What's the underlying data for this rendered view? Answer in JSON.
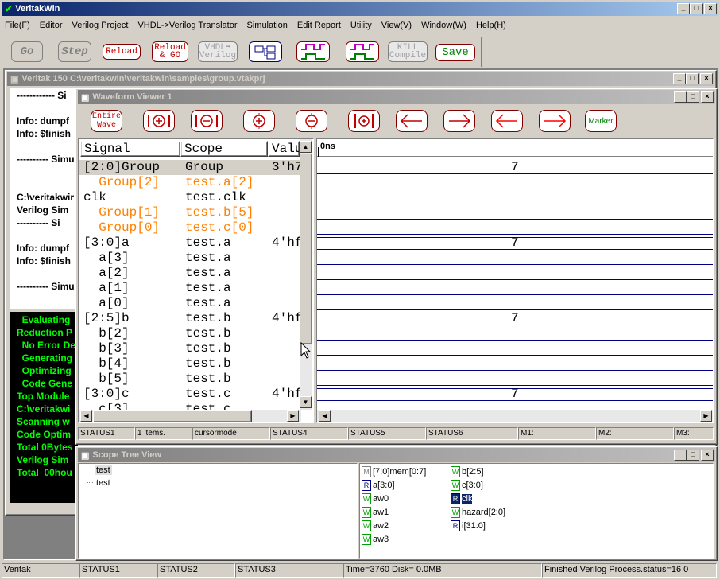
{
  "app": {
    "title": "VeritakWin"
  },
  "menu": [
    "File(F)",
    "Editor",
    "Verilog Project",
    "VHDL->Verilog Translator",
    "Simulation",
    "Edit Report",
    "Utility",
    "View(V)",
    "Window(W)",
    "Help(H)"
  ],
  "toolbar": {
    "go": "Go",
    "step": "Step",
    "reload": "Reload",
    "reload_go_1": "Reload",
    "reload_go_2": "& GO",
    "vhdl_1": "VHDL➡",
    "vhdl_2": "Verilog",
    "kill_1": "KILL",
    "kill_2": "Compile",
    "save": "Save"
  },
  "project_window": {
    "title": "Veritak 150 C:\\veritakwin\\veritakwin\\samples\\group.vtakprj",
    "console": [
      "------------ Si",
      "",
      "Info: dumpf",
      "Info: $finish",
      "",
      "---------- Simu",
      "",
      "",
      "C:\\veritakwir",
      "Verilog Sim",
      "---------- Si",
      "",
      "Info: dumpf",
      "Info: $finish",
      "",
      "---------- Simu"
    ],
    "green": [
      "  Evaluating",
      "Reduction P",
      "  No Error De",
      "  Generating",
      "  Optimizing",
      "  Code Gene",
      "Top Module",
      "C:\\veritakwi",
      "Scanning w",
      "Code Optim",
      "Total 0Bytes",
      "Verilog Sim",
      "Total  00hou"
    ]
  },
  "waveform": {
    "title": "Waveform Viewer 1",
    "btn_entire_1": "Entire",
    "btn_entire_2": "Wave",
    "btn_marker": "Marker",
    "headers": {
      "signal": "Signal",
      "scope": "Scope",
      "value": "Valu"
    },
    "time_label": "0ns",
    "rows": [
      {
        "signal": "[2:0]Group",
        "scope": "Group",
        "value": "3'h7",
        "orange": false,
        "selected": true,
        "wave": "7"
      },
      {
        "signal": "  Group[2]",
        "scope": "test.a[2]",
        "value": "",
        "orange": true,
        "selected": false,
        "wave": ""
      },
      {
        "signal": "clk",
        "scope": "test.clk",
        "value": "",
        "orange": false,
        "selected": false,
        "wave": ""
      },
      {
        "signal": "  Group[1]",
        "scope": "test.b[5]",
        "value": "",
        "orange": true,
        "selected": false,
        "wave": ""
      },
      {
        "signal": "  Group[0]",
        "scope": "test.c[0]",
        "value": "",
        "orange": true,
        "selected": false,
        "wave": ""
      },
      {
        "signal": "[3:0]a",
        "scope": "test.a",
        "value": "4'hf",
        "orange": false,
        "selected": false,
        "wave": "7"
      },
      {
        "signal": "  a[3]",
        "scope": "test.a",
        "value": "",
        "orange": false,
        "selected": false,
        "wave": ""
      },
      {
        "signal": "  a[2]",
        "scope": "test.a",
        "value": "",
        "orange": false,
        "selected": false,
        "wave": ""
      },
      {
        "signal": "  a[1]",
        "scope": "test.a",
        "value": "",
        "orange": false,
        "selected": false,
        "wave": ""
      },
      {
        "signal": "  a[0]",
        "scope": "test.a",
        "value": "",
        "orange": false,
        "selected": false,
        "wave": ""
      },
      {
        "signal": "[2:5]b",
        "scope": "test.b",
        "value": "4'hf",
        "orange": false,
        "selected": false,
        "wave": "7"
      },
      {
        "signal": "  b[2]",
        "scope": "test.b",
        "value": "",
        "orange": false,
        "selected": false,
        "wave": ""
      },
      {
        "signal": "  b[3]",
        "scope": "test.b",
        "value": "",
        "orange": false,
        "selected": false,
        "wave": ""
      },
      {
        "signal": "  b[4]",
        "scope": "test.b",
        "value": "",
        "orange": false,
        "selected": false,
        "wave": ""
      },
      {
        "signal": "  b[5]",
        "scope": "test.b",
        "value": "",
        "orange": false,
        "selected": false,
        "wave": ""
      },
      {
        "signal": "[3:0]c",
        "scope": "test.c",
        "value": "4'hf",
        "orange": false,
        "selected": false,
        "wave": "7"
      },
      {
        "signal": "  c[3]",
        "scope": "test.c",
        "value": "",
        "orange": false,
        "selected": false,
        "wave": ""
      }
    ],
    "status": [
      "STATUS1",
      "1 items.",
      "cursormode",
      "STATUS4",
      "STATUS5",
      "STATUS6",
      "M1:",
      "M2:",
      "M3:"
    ]
  },
  "scope_tree": {
    "title": "Scope Tree View",
    "tree": [
      "test",
      "test"
    ],
    "vars_left": [
      {
        "kind": "M",
        "name": "[7:0]mem[0:7]"
      },
      {
        "kind": "R",
        "name": "a[3:0]"
      },
      {
        "kind": "W",
        "name": "aw0"
      },
      {
        "kind": "W",
        "name": "aw1"
      },
      {
        "kind": "W",
        "name": "aw2"
      },
      {
        "kind": "W",
        "name": "aw3"
      }
    ],
    "vars_right": [
      {
        "kind": "W",
        "name": "b[2:5]"
      },
      {
        "kind": "W",
        "name": "c[3:0]"
      },
      {
        "kind": "R",
        "name": "clk",
        "selected": true
      },
      {
        "kind": "W",
        "name": "hazard[2:0]"
      },
      {
        "kind": "R",
        "name": "i[31:0]"
      }
    ]
  },
  "statusbar": [
    "Veritak",
    "STATUS1",
    "STATUS2",
    "STATUS3",
    "Time=3760 Disk=  0.0MB",
    "Finished Verilog Process.status=16 0"
  ]
}
